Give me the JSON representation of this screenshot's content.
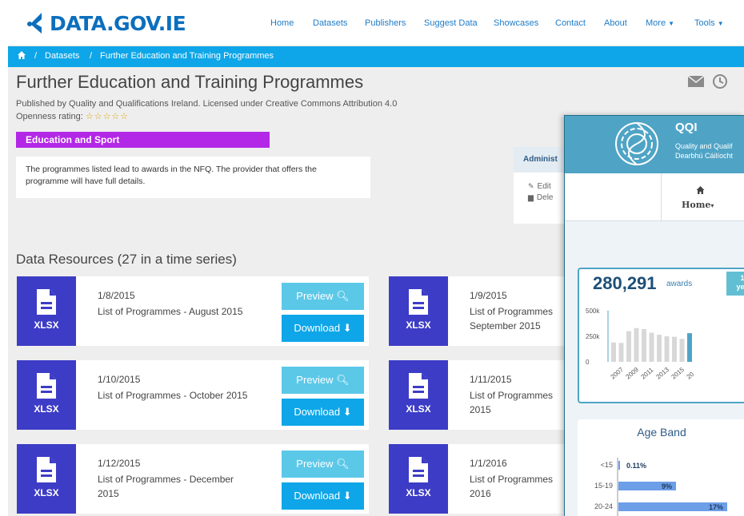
{
  "site": {
    "logo_text": "DATA.GOV.IE",
    "nav": [
      {
        "label": "Home"
      },
      {
        "label": "Datasets"
      },
      {
        "label": "Publishers"
      },
      {
        "label": "Suggest Data"
      },
      {
        "label": "Showcases"
      },
      {
        "label": "Contact"
      },
      {
        "label": "About"
      },
      {
        "label": "More"
      },
      {
        "label": "Tools"
      }
    ]
  },
  "breadcrumb": {
    "home_icon": "home-icon",
    "datasets": "Datasets",
    "current": "Further Education and Training Programmes",
    "sep": "/"
  },
  "dataset": {
    "title": "Further Education and Training Programmes",
    "published": "Published by Quality and Qualifications Ireland.   Licensed under Creative Commons Attribution 4.0",
    "openness_label": "Openness rating:",
    "openness_stars": "☆☆☆☆☆",
    "category": "Education and Sport",
    "description": "The programmes listed lead to awards in the NFQ. The provider that offers the programme will have full details.",
    "admin_title": "Administ",
    "admin_edit": "Edit",
    "admin_delete": "Dele"
  },
  "resources": {
    "heading": "Data Resources (27 in a time series)",
    "preview_label": "Preview",
    "download_label": "Download",
    "items": [
      {
        "format": "XLSX",
        "date": "1/8/2015",
        "name": "List of Programmes - August 2015"
      },
      {
        "format": "XLSX",
        "date": "1/9/2015",
        "name": "List of Programmes",
        "name2": "September 2015"
      },
      {
        "format": "XLSX",
        "date": "1/10/2015",
        "name": "List of Programmes - October 2015"
      },
      {
        "format": "XLSX",
        "date": "1/11/2015",
        "name": "List of Programmes",
        "name2": "2015"
      },
      {
        "format": "XLSX",
        "date": "1/12/2015",
        "name": "List of Programmes - December 2015"
      },
      {
        "format": "XLSX",
        "date": "1/1/2016",
        "name": "List of Programmes",
        "name2": "2016"
      }
    ]
  },
  "qqi": {
    "brand": "QQI",
    "sub1": "Quality and Qualif",
    "sub2": "Dearbhú Cáilíocht",
    "home_label": "Home",
    "awards_value": "280,291",
    "awards_label": "awards",
    "awards_badge": "1\nyea",
    "age_title": "Age Band",
    "colors": {
      "header": "#4fa4c6",
      "bar_gray": "#d8d8d8",
      "bar_blue": "#4fa4c6",
      "age_bar": "#6d9ee8"
    }
  },
  "chart_data": [
    {
      "type": "bar",
      "title": "",
      "ylim": [
        0,
        500000
      ],
      "y_ticks": [
        "500k",
        "250k",
        "0"
      ],
      "x_ticks": [
        "2007",
        "2009",
        "2011",
        "2013",
        "2015",
        "20"
      ],
      "values": [
        190000,
        185000,
        300000,
        330000,
        320000,
        285000,
        265000,
        250000,
        245000,
        225000,
        280291
      ],
      "highlight_last": true
    },
    {
      "type": "bar",
      "title": "Age Band",
      "categories": [
        "<15",
        "15-19",
        "20-24"
      ],
      "values": [
        0.11,
        9,
        17
      ],
      "labels": [
        "0.11%",
        "9%",
        "17%"
      ]
    }
  ]
}
